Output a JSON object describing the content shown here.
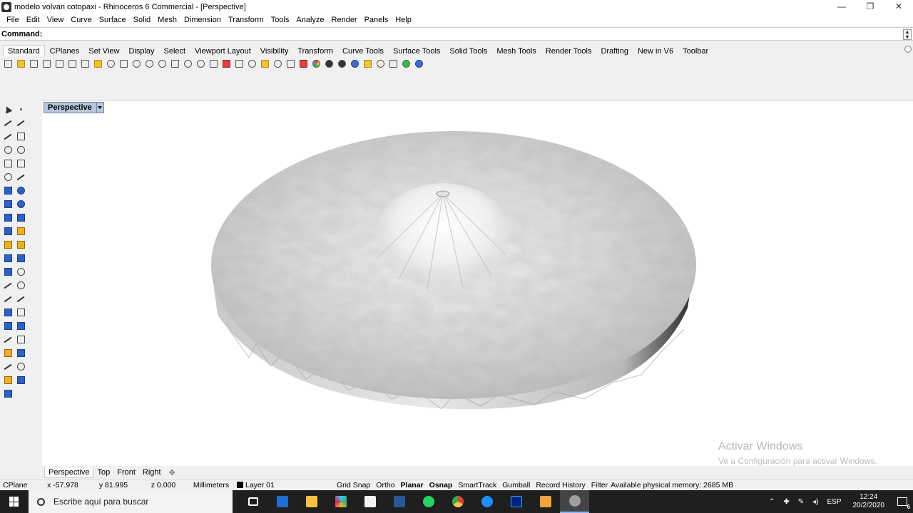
{
  "window": {
    "title": "modelo volvan cotopaxi - Rhinoceros 6 Commercial - [Perspective]",
    "controls": [
      "—",
      "❐",
      "✕"
    ]
  },
  "menu": [
    "File",
    "Edit",
    "View",
    "Curve",
    "Surface",
    "Solid",
    "Mesh",
    "Dimension",
    "Transform",
    "Tools",
    "Analyze",
    "Render",
    "Panels",
    "Help"
  ],
  "command": {
    "label": "Command:",
    "value": ""
  },
  "toolbar_tabs": [
    "Standard",
    "CPlanes",
    "Set View",
    "Display",
    "Select",
    "Viewport Layout",
    "Visibility",
    "Transform",
    "Curve Tools",
    "Surface Tools",
    "Solid Tools",
    "Mesh Tools",
    "Render Tools",
    "Drafting",
    "New in V6",
    "Toolbar"
  ],
  "active_toolbar_tab": "Standard",
  "toolbar_icons": [
    "new-file-icon",
    "open-file-icon",
    "save-icon",
    "print-icon",
    "import-icon",
    "cut-icon",
    "copy-icon",
    "paste-icon",
    "undo-icon",
    "pan-icon",
    "rotate-view-icon",
    "zoom-icon",
    "zoom-window-icon",
    "zoom-extents-icon",
    "zoom-selected-icon",
    "undo-view-icon",
    "four-viewports-icon",
    "hide-icon",
    "show-icon",
    "lock-icon",
    "layers-icon",
    "lights-icon",
    "lock-objects-icon",
    "materials-icon",
    "color-wheel-icon",
    "render-icon",
    "render-preview-icon",
    "environment-icon",
    "options-icon",
    "gear-icon",
    "filter-icon",
    "globe-icon",
    "help-icon"
  ],
  "viewport": {
    "name": "Perspective",
    "watermark_title": "Activar Windows",
    "watermark_sub": "Ve a Configuración para activar Windows."
  },
  "viewport_tabs": [
    "Perspective",
    "Top",
    "Front",
    "Right"
  ],
  "active_viewport_tab": "Perspective",
  "status": {
    "cplane": "CPlane",
    "x": "x -57.978",
    "y": "y 81.995",
    "z": "z 0.000",
    "units": "Millimeters",
    "layer": "Layer 01",
    "grid_snap": "Grid Snap",
    "ortho": "Ortho",
    "planar": "Planar",
    "osnap": "Osnap",
    "smarttrack": "SmartTrack",
    "gumball": "Gumball",
    "record_history": "Record History",
    "filter": "Filter",
    "memory": "Available physical memory: 2685 MB"
  },
  "taskbar": {
    "search_placeholder": "Escribe aquí para buscar",
    "language": "ESP",
    "time": "12:24",
    "date": "20/2/2020",
    "notification_count": "6",
    "apps": [
      {
        "name": "task-view-icon",
        "color": "#1f1f1f"
      },
      {
        "name": "mail-icon",
        "color": "#1e6fd0"
      },
      {
        "name": "file-explorer-icon",
        "color": "#f5c342"
      },
      {
        "name": "slack-icon",
        "color": "#4a154b"
      },
      {
        "name": "store-icon",
        "color": "#f3f3f3"
      },
      {
        "name": "documents-icon",
        "color": "#2b5797"
      },
      {
        "name": "whatsapp-icon",
        "color": "#25d366"
      },
      {
        "name": "chrome-icon",
        "color": "#e44134"
      },
      {
        "name": "edge-icon",
        "color": "#1e90ff"
      },
      {
        "name": "photoshop-icon",
        "color": "#00237f"
      },
      {
        "name": "app-n-icon",
        "color": "#f2a33a"
      },
      {
        "name": "rhino-icon",
        "color": "#9e9e9e"
      }
    ]
  },
  "colors": {
    "viewport_title_bg": "#b6c6dd",
    "taskbar_bg": "#1f1f1f"
  }
}
